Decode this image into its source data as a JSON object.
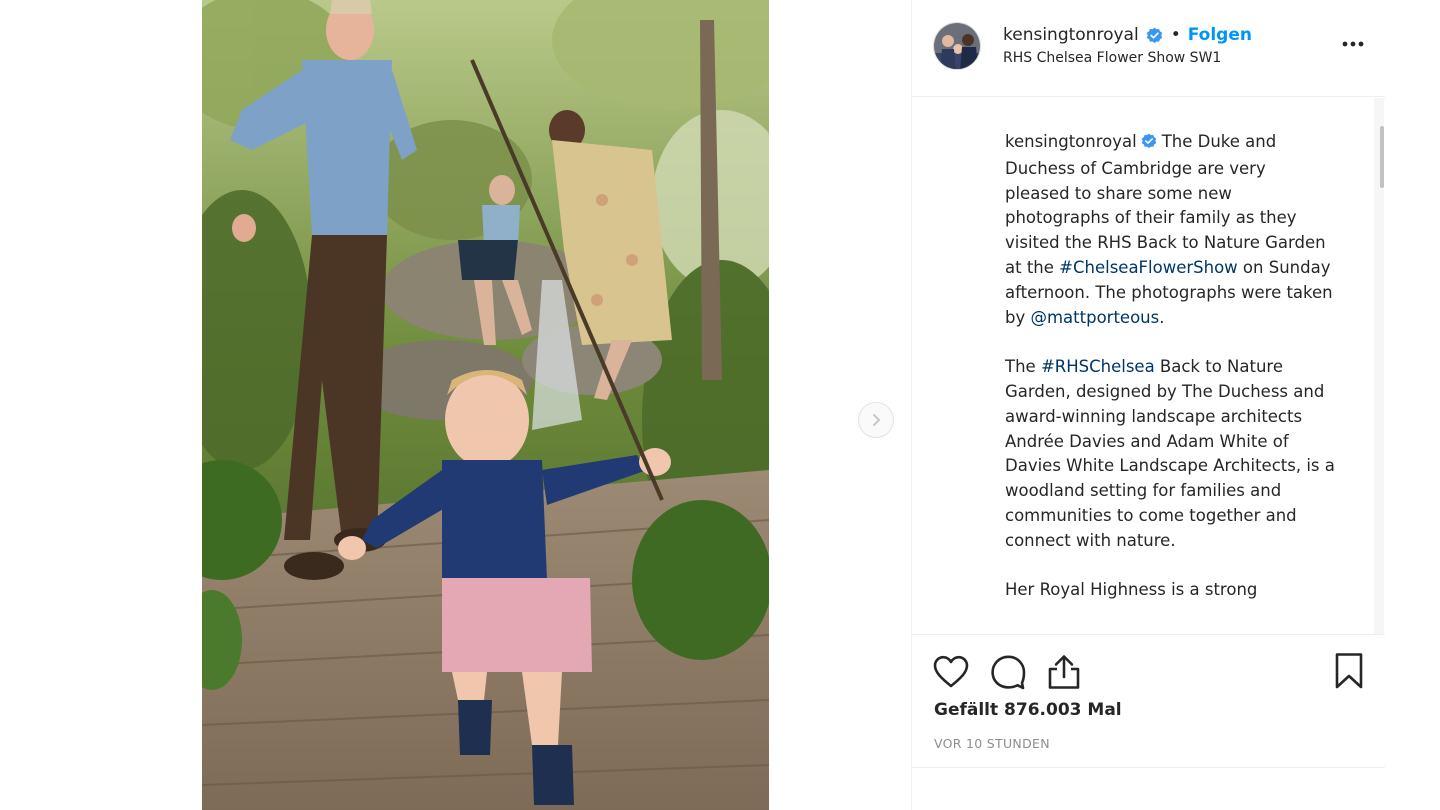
{
  "post": {
    "username": "kensingtonroyal",
    "dot": "•",
    "follow_label": "Folgen",
    "location": "RHS Chelsea Flower Show SW1",
    "more_label": "more-options"
  },
  "caption": {
    "username": "kensingtonroyal",
    "p1_a": "The Duke and Duchess of Cambridge are very pleased to share some new photographs of their family as they visited the RHS Back to Nature Garden at the ",
    "p1_hashtag": "#ChelseaFlowerShow",
    "p1_b": " on Sunday afternoon. The photographs were taken by ",
    "p1_mention": "@mattporteous",
    "p1_c": ".",
    "p2_a": "The ",
    "p2_hashtag": "#RHSChelsea",
    "p2_b": " Back to Nature Garden, designed by The Duchess and award-winning landscape architects Andrée Davies and Adam White of Davies White Landscape Architects, is a woodland setting for families and communities to come together and connect with nature.",
    "p3": "Her Royal Highness is a strong"
  },
  "stats": {
    "likes": "Gefällt 876.003 Mal",
    "timestamp": "VOR 10 STUNDEN"
  },
  "colors": {
    "link": "#003569",
    "follow": "#0095f6",
    "verified": "#3897f0",
    "muted": "#8e8e8e"
  },
  "icons": [
    "heart-icon",
    "comment-icon",
    "share-icon",
    "bookmark-icon",
    "chevron-right-icon",
    "verified-badge-icon",
    "more-icon"
  ]
}
